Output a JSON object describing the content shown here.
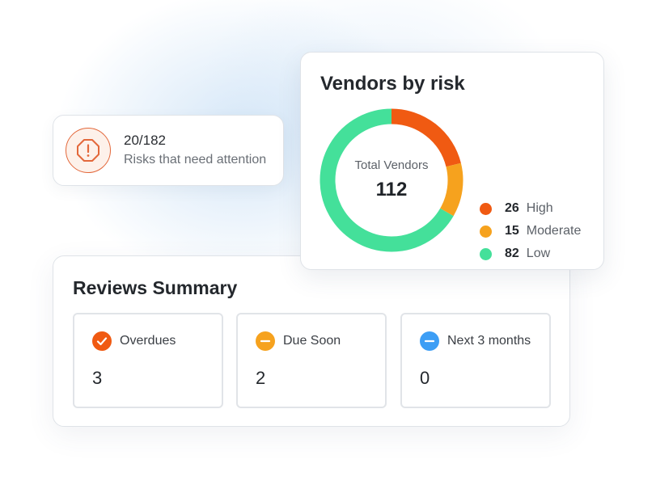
{
  "risk_card": {
    "count": "20/182",
    "label": "Risks that need attention",
    "icon": "octagon-alert-icon",
    "color": "#e3683b"
  },
  "vendors": {
    "title": "Vendors by risk",
    "center_label": "Total Vendors",
    "total": "112",
    "legend": [
      {
        "value": "26",
        "label": "High",
        "color": "#f05a12"
      },
      {
        "value": "15",
        "label": "Moderate",
        "color": "#f6a21e"
      },
      {
        "value": "82",
        "label": "Low",
        "color": "#44e09a"
      }
    ]
  },
  "chart_data": {
    "type": "pie",
    "title": "Vendors by risk",
    "categories": [
      "High",
      "Moderate",
      "Low"
    ],
    "values": [
      26,
      15,
      82
    ],
    "colors": [
      "#f05a12",
      "#f6a21e",
      "#44e09a"
    ],
    "center_label": "Total Vendors",
    "center_value": 112,
    "donut": true
  },
  "reviews": {
    "title": "Reviews Summary",
    "tiles": [
      {
        "label": "Overdues",
        "value": "3",
        "icon": "check-circle-icon",
        "color": "#f05a12"
      },
      {
        "label": "Due Soon",
        "value": "2",
        "icon": "minus-circle-icon",
        "color": "#f6a21e"
      },
      {
        "label": "Next 3 months",
        "value": "0",
        "icon": "minus-circle-icon",
        "color": "#3d9ef5"
      }
    ]
  }
}
